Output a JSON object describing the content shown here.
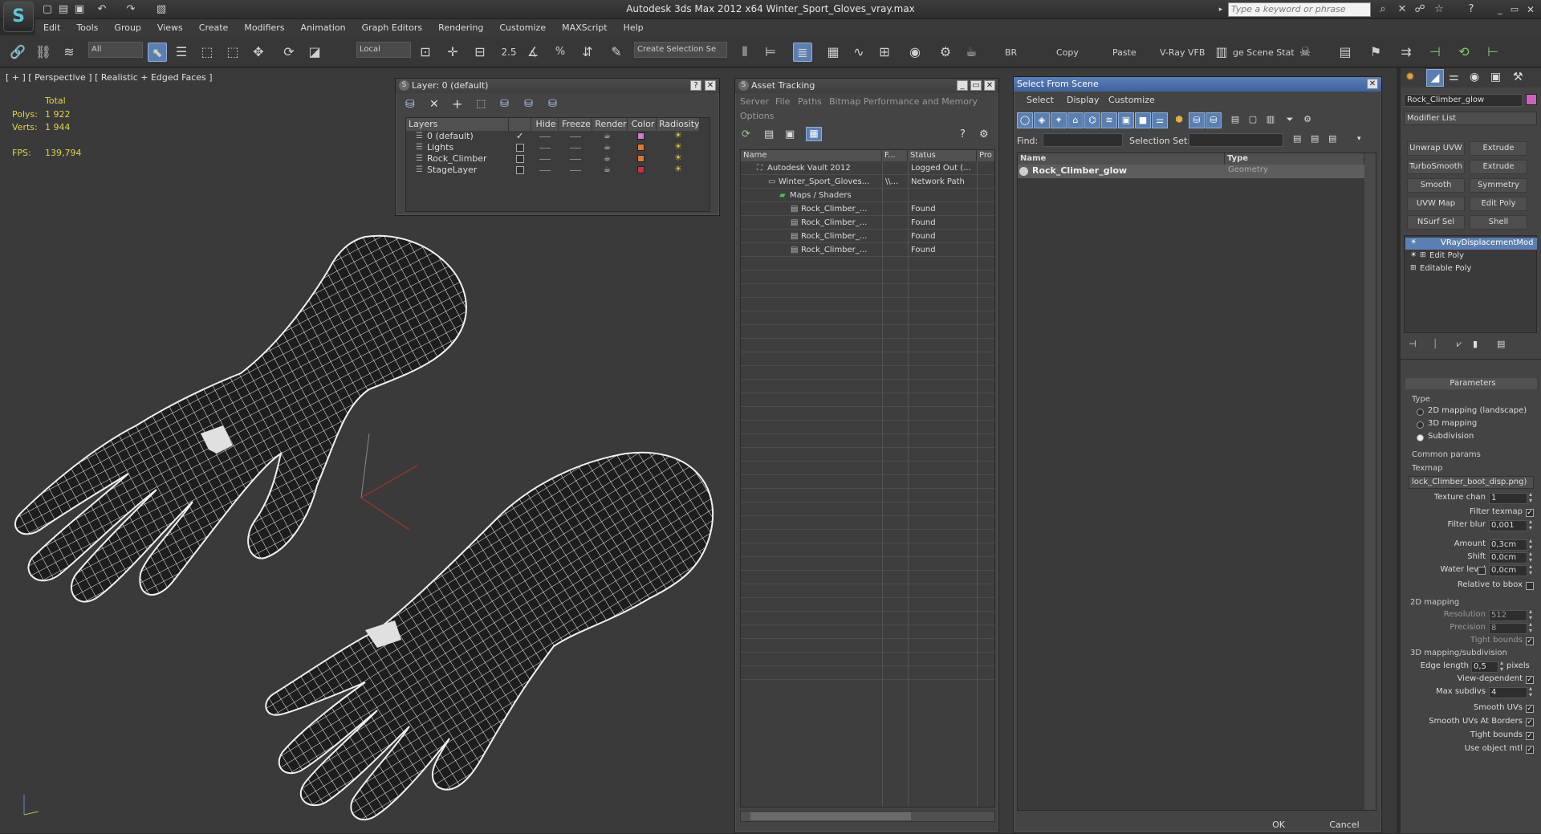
{
  "window": {
    "title": "Autodesk 3ds Max  2012 x64    Winter_Sport_Gloves_vray.max",
    "search_placeholder": "Type a keyword or phrase"
  },
  "menu": [
    "Edit",
    "Tools",
    "Group",
    "Views",
    "Create",
    "Modifiers",
    "Animation",
    "Graph Editors",
    "Rendering",
    "Customize",
    "MAXScript",
    "Help"
  ],
  "toolbar": {
    "filter": "All",
    "coord": "Local",
    "named_sel": "Create Selection Se",
    "texts": [
      "BR",
      "Copy",
      "Paste",
      "V-Ray VFB",
      "ge Scene Stat"
    ]
  },
  "viewport": {
    "label": "[ + ] [ Perspective ] [ Realistic + Edged Faces ]",
    "stats": {
      "total_label": "Total",
      "polys_label": "Polys:",
      "polys": "1 922",
      "verts_label": "Verts:",
      "verts": "1 944",
      "fps_label": "FPS:",
      "fps": "139,794"
    }
  },
  "layer_panel": {
    "title": "Layer: 0 (default)",
    "columns": [
      "Layers",
      "Hide",
      "Freeze",
      "Render",
      "Color",
      "Radiosity"
    ],
    "rows": [
      {
        "name": "0 (default)",
        "color": "#d07ad0",
        "active": true
      },
      {
        "name": "Lights",
        "color": "#d87a30",
        "active": false
      },
      {
        "name": "Rock_Climber",
        "color": "#d87a30",
        "active": false
      },
      {
        "name": "StageLayer",
        "color": "#c8304a",
        "active": false
      }
    ]
  },
  "asset_panel": {
    "title": "Asset Tracking",
    "menu": [
      "Server",
      "File",
      "Paths",
      "Bitmap Performance and Memory",
      "Options"
    ],
    "columns": [
      "Name",
      "F...",
      "Status",
      "Pro"
    ],
    "rows": [
      {
        "name": "Autodesk Vault 2012",
        "f": "",
        "status": "Logged Out (...",
        "indent": 1
      },
      {
        "name": "Winter_Sport_Gloves...",
        "f": "\\\\...",
        "status": "Network Path",
        "indent": 2
      },
      {
        "name": "Maps / Shaders",
        "f": "",
        "status": "",
        "indent": 3
      },
      {
        "name": "Rock_Climber_...",
        "f": "",
        "status": "Found",
        "indent": 4
      },
      {
        "name": "Rock_Climber_...",
        "f": "",
        "status": "Found",
        "indent": 4
      },
      {
        "name": "Rock_Climber_...",
        "f": "",
        "status": "Found",
        "indent": 4
      },
      {
        "name": "Rock_Climber_...",
        "f": "",
        "status": "Found",
        "indent": 4
      }
    ]
  },
  "select_panel": {
    "title": "Select From Scene",
    "menu": [
      "Select",
      "Display",
      "Customize"
    ],
    "find_label": "Find:",
    "selset_label": "Selection Set:",
    "columns": [
      "Name",
      "Type"
    ],
    "rows": [
      {
        "name": "Rock_Climber_glow",
        "type": "Geometry"
      }
    ],
    "ok": "OK",
    "cancel": "Cancel"
  },
  "command_panel": {
    "object_name": "Rock_Climber_glow",
    "modifier_list": "Modifier List",
    "buttons": [
      "Unwrap UVW",
      "Extrude",
      "TurboSmooth",
      "Extrude",
      "Smooth",
      "Symmetry",
      "UVW Map",
      "Edit Poly",
      "NSurf Sel",
      "Shell"
    ],
    "stack": [
      "VRayDisplacementMod",
      "Edit Poly",
      "Editable Poly"
    ],
    "params_title": "Parameters",
    "type_label": "Type",
    "type_options": [
      "2D mapping (landscape)",
      "3D mapping",
      "Subdivision"
    ],
    "common_label": "Common params",
    "texmap_label": "Texmap",
    "texmap_value": "lock_Climber_boot_disp.png)",
    "texture_chan_label": "Texture chan",
    "texture_chan": "1",
    "filter_texmap_label": "Filter texmap",
    "filter_blur_label": "Filter blur",
    "filter_blur": "0,001",
    "amount_label": "Amount",
    "amount": "0,3cm",
    "shift_label": "Shift",
    "shift": "0,0cm",
    "water_label": "Water level",
    "water": "0,0cm",
    "relative_label": "Relative to bbox",
    "map2d_label": "2D mapping",
    "resolution_label": "Resolution",
    "resolution": "512",
    "precision_label": "Precision",
    "precision": "8",
    "tight1_label": "Tight bounds",
    "map3d_label": "3D mapping/subdivision",
    "edge_label": "Edge length",
    "edge": "0,5",
    "pixels_label": "pixels",
    "viewdep_label": "View-dependent",
    "maxsub_label": "Max subdivs",
    "maxsub": "4",
    "smooth_uvs_label": "Smooth UVs",
    "smooth_borders_label": "Smooth UVs At Borders",
    "tight2_label": "Tight bounds",
    "use_obj_label": "Use object mtl"
  }
}
